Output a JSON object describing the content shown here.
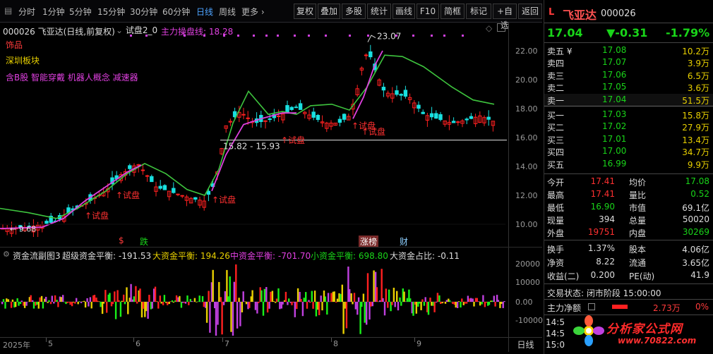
{
  "toolbar": {
    "periods": [
      "分时",
      "1分钟",
      "5分钟",
      "15分钟",
      "30分钟",
      "60分钟",
      "日线",
      "周线",
      "更多 ›"
    ],
    "active_period": "日线",
    "buttons": [
      "复权",
      "叠加",
      "多股",
      "统计",
      "画线",
      "F10",
      "简框",
      "标记",
      "+自选",
      "返回"
    ]
  },
  "chart": {
    "code_title": "000026 飞亚达(日线,前复权)",
    "indicator_name": "试盘2_0",
    "indicator_line_label": "主力操盘线: 18.28",
    "tags": [
      "饰品",
      "深圳板块",
      "含B股 智能穿戴 机器人概念 减速器"
    ],
    "price_axis": [
      "22.00",
      "20.00",
      "18.00",
      "16.00",
      "14.00",
      "12.00",
      "10.00"
    ],
    "high_marker": "23.07",
    "low_marker": "9.68",
    "range_label": "15.82 - 15.93",
    "trial_label": "试盘",
    "event_markers": [
      "$",
      "跌",
      "涨榜",
      "财"
    ],
    "x_axis": [
      "2025年",
      "5",
      "6",
      "7",
      "8",
      "9"
    ],
    "x_axis_period": "日线"
  },
  "flow": {
    "title": "资金流副图3",
    "items": [
      {
        "label": "超级资金平衡: -191.53",
        "color": "#dddddd"
      },
      {
        "label": "大资金平衡: 194.26",
        "color": "#e8d000"
      },
      {
        "label": "中资金平衡: -701.70",
        "color": "#e040e0"
      },
      {
        "label": "小资金平衡: 698.80",
        "color": "#19d419"
      },
      {
        "label": "大资金占比: -0.11",
        "color": "#dddddd"
      }
    ],
    "axis": [
      "20000",
      "10000",
      "0.00",
      "-10000"
    ]
  },
  "quote": {
    "marker": "L",
    "name": "飞亚达",
    "code": "000026",
    "price": "17.04",
    "change": "▼-0.31",
    "change_pct": "-1.79%",
    "asks": [
      {
        "label": "卖五 ¥",
        "price": "17.08",
        "vol": "10.2万"
      },
      {
        "label": "卖四",
        "price": "17.07",
        "vol": "3.9万"
      },
      {
        "label": "卖三",
        "price": "17.06",
        "vol": "6.5万"
      },
      {
        "label": "卖二",
        "price": "17.05",
        "vol": "3.6万"
      },
      {
        "label": "卖一",
        "price": "17.04",
        "vol": "51.5万"
      }
    ],
    "bids": [
      {
        "label": "买一",
        "price": "17.03",
        "vol": "15.8万"
      },
      {
        "label": "买二",
        "price": "17.02",
        "vol": "27.9万"
      },
      {
        "label": "买三",
        "price": "17.01",
        "vol": "13.4万"
      },
      {
        "label": "买四",
        "price": "17.00",
        "vol": "34.7万"
      },
      {
        "label": "买五",
        "price": "16.99",
        "vol": "9.9万"
      }
    ],
    "stats": [
      {
        "l1": "今开",
        "v1": "17.41",
        "c1": "red",
        "l2": "均价",
        "v2": "17.08",
        "c2": "green"
      },
      {
        "l1": "最高",
        "v1": "17.41",
        "c1": "red",
        "l2": "量比",
        "v2": "0.52",
        "c2": "green"
      },
      {
        "l1": "最低",
        "v1": "16.90",
        "c1": "green",
        "l2": "市值",
        "v2": "69.1亿",
        "c2": "white"
      },
      {
        "l1": "现量",
        "v1": "394",
        "c1": "white",
        "l2": "总量",
        "v2": "50020",
        "c2": "white"
      },
      {
        "l1": "外盘",
        "v1": "19751",
        "c1": "red",
        "l2": "内盘",
        "v2": "30269",
        "c2": "green"
      }
    ],
    "stats2": [
      {
        "l1": "换手",
        "v1": "1.37%",
        "l2": "股本",
        "v2": "4.06亿"
      },
      {
        "l1": "净资",
        "v1": "8.22",
        "l2": "流通",
        "v2": "3.65亿"
      },
      {
        "l1": "收益(二)",
        "v1": "0.200",
        "l2": "PE(动)",
        "v2": "41.9"
      }
    ],
    "trade_status": "交易状态: 闭市阶段 15:00:00",
    "net_flow_label": "主力净额",
    "net_flow_value": "2.73万",
    "net_flow_pct": "0%",
    "times": [
      "14:5",
      "14:5",
      "15:0"
    ],
    "watermark": "分析家公式网",
    "watermark_url": "www.70822.com"
  },
  "colors": {
    "up": "#ff2020",
    "down": "#19e0e0",
    "ma": "#3ec43e",
    "main_line": "#e040e0"
  }
}
